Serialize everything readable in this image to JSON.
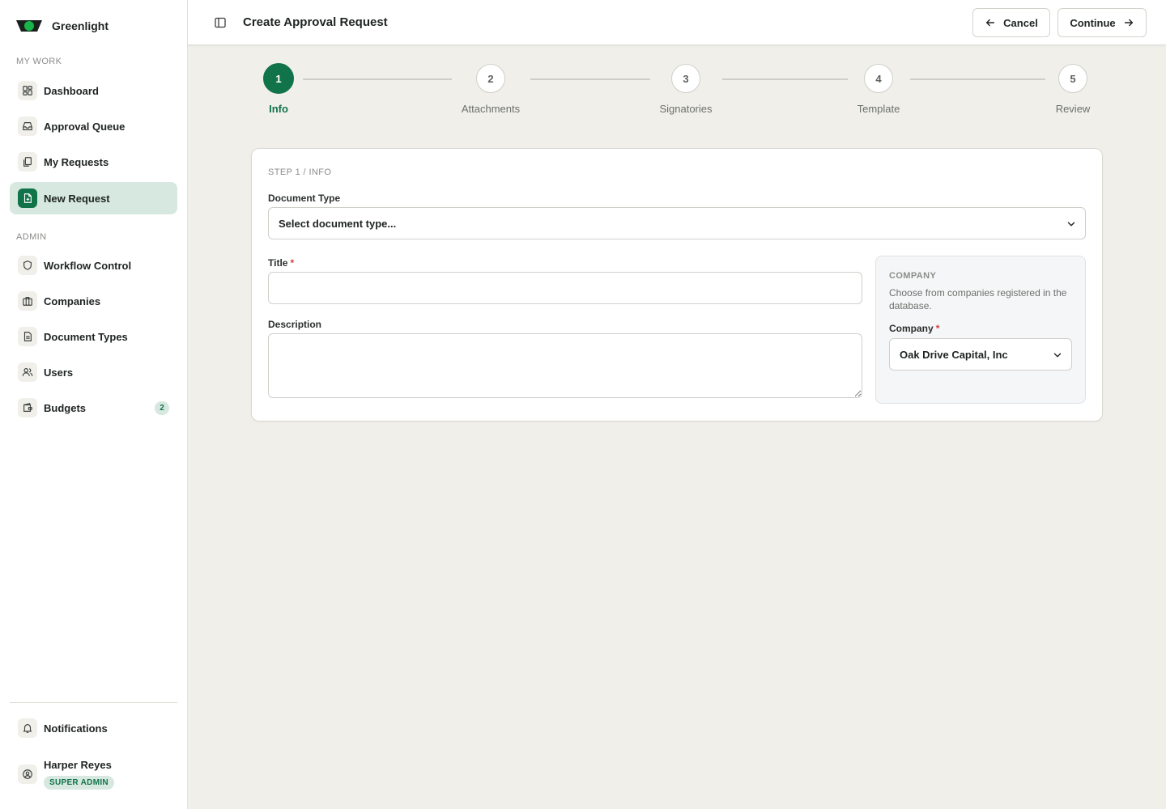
{
  "app": {
    "name": "Greenlight"
  },
  "sidebar": {
    "sections": {
      "my_work": "MY WORK",
      "admin": "ADMIN"
    },
    "my_work_items": [
      {
        "label": "Dashboard",
        "icon": "dashboard-icon"
      },
      {
        "label": "Approval Queue",
        "icon": "inbox-icon"
      },
      {
        "label": "My Requests",
        "icon": "files-icon"
      },
      {
        "label": "New Request",
        "icon": "file-plus-icon",
        "active": true
      }
    ],
    "admin_items": [
      {
        "label": "Workflow Control",
        "icon": "shield-icon"
      },
      {
        "label": "Companies",
        "icon": "briefcase-icon"
      },
      {
        "label": "Document Types",
        "icon": "document-icon"
      },
      {
        "label": "Users",
        "icon": "users-icon"
      },
      {
        "label": "Budgets",
        "icon": "wallet-icon",
        "badge": "2"
      }
    ],
    "notifications_label": "Notifications",
    "user": {
      "name": "Harper Reyes",
      "role": "SUPER ADMIN"
    }
  },
  "header": {
    "title": "Create Approval Request",
    "cancel_label": "Cancel",
    "continue_label": "Continue"
  },
  "stepper": {
    "current": 1,
    "steps": [
      {
        "number": "1",
        "label": "Info"
      },
      {
        "number": "2",
        "label": "Attachments"
      },
      {
        "number": "3",
        "label": "Signatories"
      },
      {
        "number": "4",
        "label": "Template"
      },
      {
        "number": "5",
        "label": "Review"
      }
    ]
  },
  "form": {
    "step_kicker": "STEP 1 / INFO",
    "document_type": {
      "label": "Document Type",
      "value": "Select document type..."
    },
    "title_field": {
      "label": "Title",
      "required_mark": "*",
      "value": ""
    },
    "description_field": {
      "label": "Description",
      "value": ""
    },
    "company_panel": {
      "heading": "COMPANY",
      "help": "Choose from companies registered in the database.",
      "label": "Company",
      "required_mark": "*",
      "value": "Oak Drive Capital, Inc"
    }
  },
  "colors": {
    "accent": "#11734a",
    "accent_soft": "#d6e8df",
    "background": "#f0efea",
    "required": "#d63c3c"
  }
}
